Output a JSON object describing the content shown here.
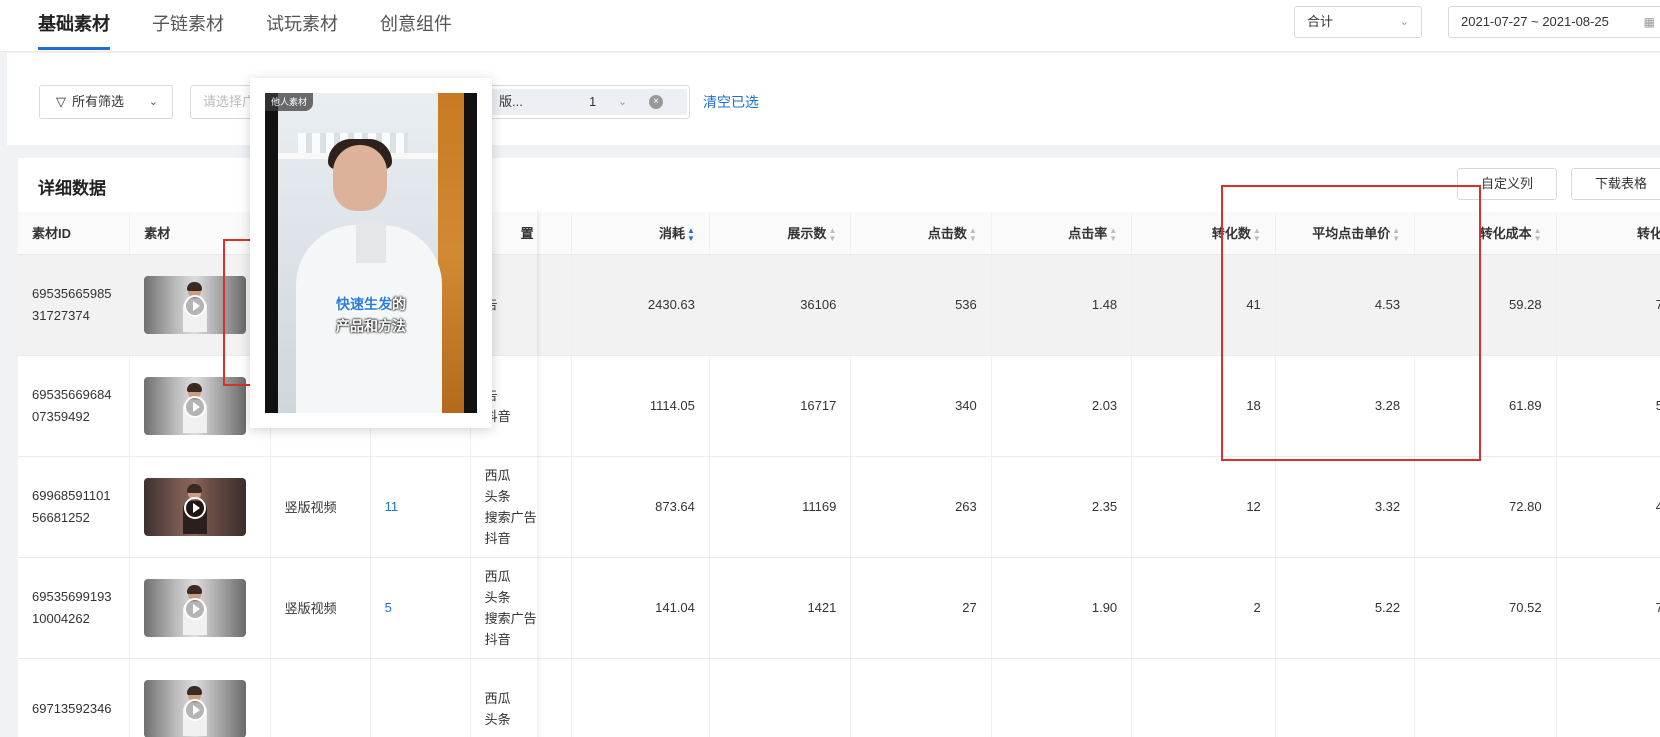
{
  "tabs": [
    {
      "label": "基础素材",
      "active": true
    },
    {
      "label": "子链素材",
      "active": false
    },
    {
      "label": "试玩素材",
      "active": false
    },
    {
      "label": "创意组件",
      "active": false
    }
  ],
  "summary_select": {
    "value": "合计"
  },
  "date_range": {
    "value": "2021-07-27 ~ 2021-08-25"
  },
  "filters": {
    "all_filters_label": "所有筛选",
    "ad_select_placeholder": "请选择广告",
    "chip_text": "版...",
    "chip_count": "1",
    "clear_label": "清空已选"
  },
  "panel": {
    "title": "详细数据",
    "custom_columns_label": "自定义列",
    "download_label": "下载表格"
  },
  "table": {
    "columns": [
      "素材ID",
      "素材",
      "",
      "",
      "置",
      "消耗",
      "展示数",
      "点击数",
      "点击率",
      "转化数",
      "平均点击单价",
      "转化成本",
      "转化"
    ],
    "rows": [
      {
        "id_line1": "69535665985",
        "id_line2": "31727374",
        "type": "",
        "count": "",
        "placement": [
          "",
          "",
          "告",
          ""
        ],
        "spend": "2430.63",
        "impressions": "36106",
        "clicks": "536",
        "ctr": "1.48",
        "conversions": "41",
        "avg_cpc": "4.53",
        "cpa": "59.28",
        "conv_rate": "7",
        "thumb": "light",
        "highlight": true
      },
      {
        "id_line1": "69535669684",
        "id_line2": "07359492",
        "type": "",
        "count": "",
        "placement": [
          "",
          "",
          "告",
          "抖音"
        ],
        "spend": "1114.05",
        "impressions": "16717",
        "clicks": "340",
        "ctr": "2.03",
        "conversions": "18",
        "avg_cpc": "3.28",
        "cpa": "61.89",
        "conv_rate": "5",
        "thumb": "light",
        "highlight": false
      },
      {
        "id_line1": "69968591101",
        "id_line2": "56681252",
        "type": "竖版视频",
        "count": "11",
        "placement": [
          "西瓜",
          "头条",
          "搜索广告",
          "抖音"
        ],
        "spend": "873.64",
        "impressions": "11169",
        "clicks": "263",
        "ctr": "2.35",
        "conversions": "12",
        "avg_cpc": "3.32",
        "cpa": "72.80",
        "conv_rate": "4",
        "thumb": "dark",
        "highlight": false
      },
      {
        "id_line1": "69535699193",
        "id_line2": "10004262",
        "type": "竖版视频",
        "count": "5",
        "placement": [
          "西瓜",
          "头条",
          "搜索广告",
          "抖音"
        ],
        "spend": "141.04",
        "impressions": "1421",
        "clicks": "27",
        "ctr": "1.90",
        "conversions": "2",
        "avg_cpc": "5.22",
        "cpa": "70.52",
        "conv_rate": "7",
        "thumb": "light",
        "highlight": false
      },
      {
        "id_line1": "69713592346",
        "id_line2": "",
        "type": "",
        "count": "",
        "placement": [
          "西瓜",
          "头条",
          "",
          ""
        ],
        "spend": "",
        "impressions": "",
        "clicks": "",
        "ctr": "",
        "conversions": "",
        "avg_cpc": "",
        "cpa": "",
        "conv_rate": "",
        "thumb": "light",
        "highlight": false
      }
    ]
  },
  "preview": {
    "tag": "他人素材",
    "caption_highlight": "快速生发",
    "caption_line1_rest": "的",
    "caption_line2": "产品和方法"
  },
  "colors": {
    "accent": "#1f6fd1",
    "annotation_red": "#d9302c"
  }
}
